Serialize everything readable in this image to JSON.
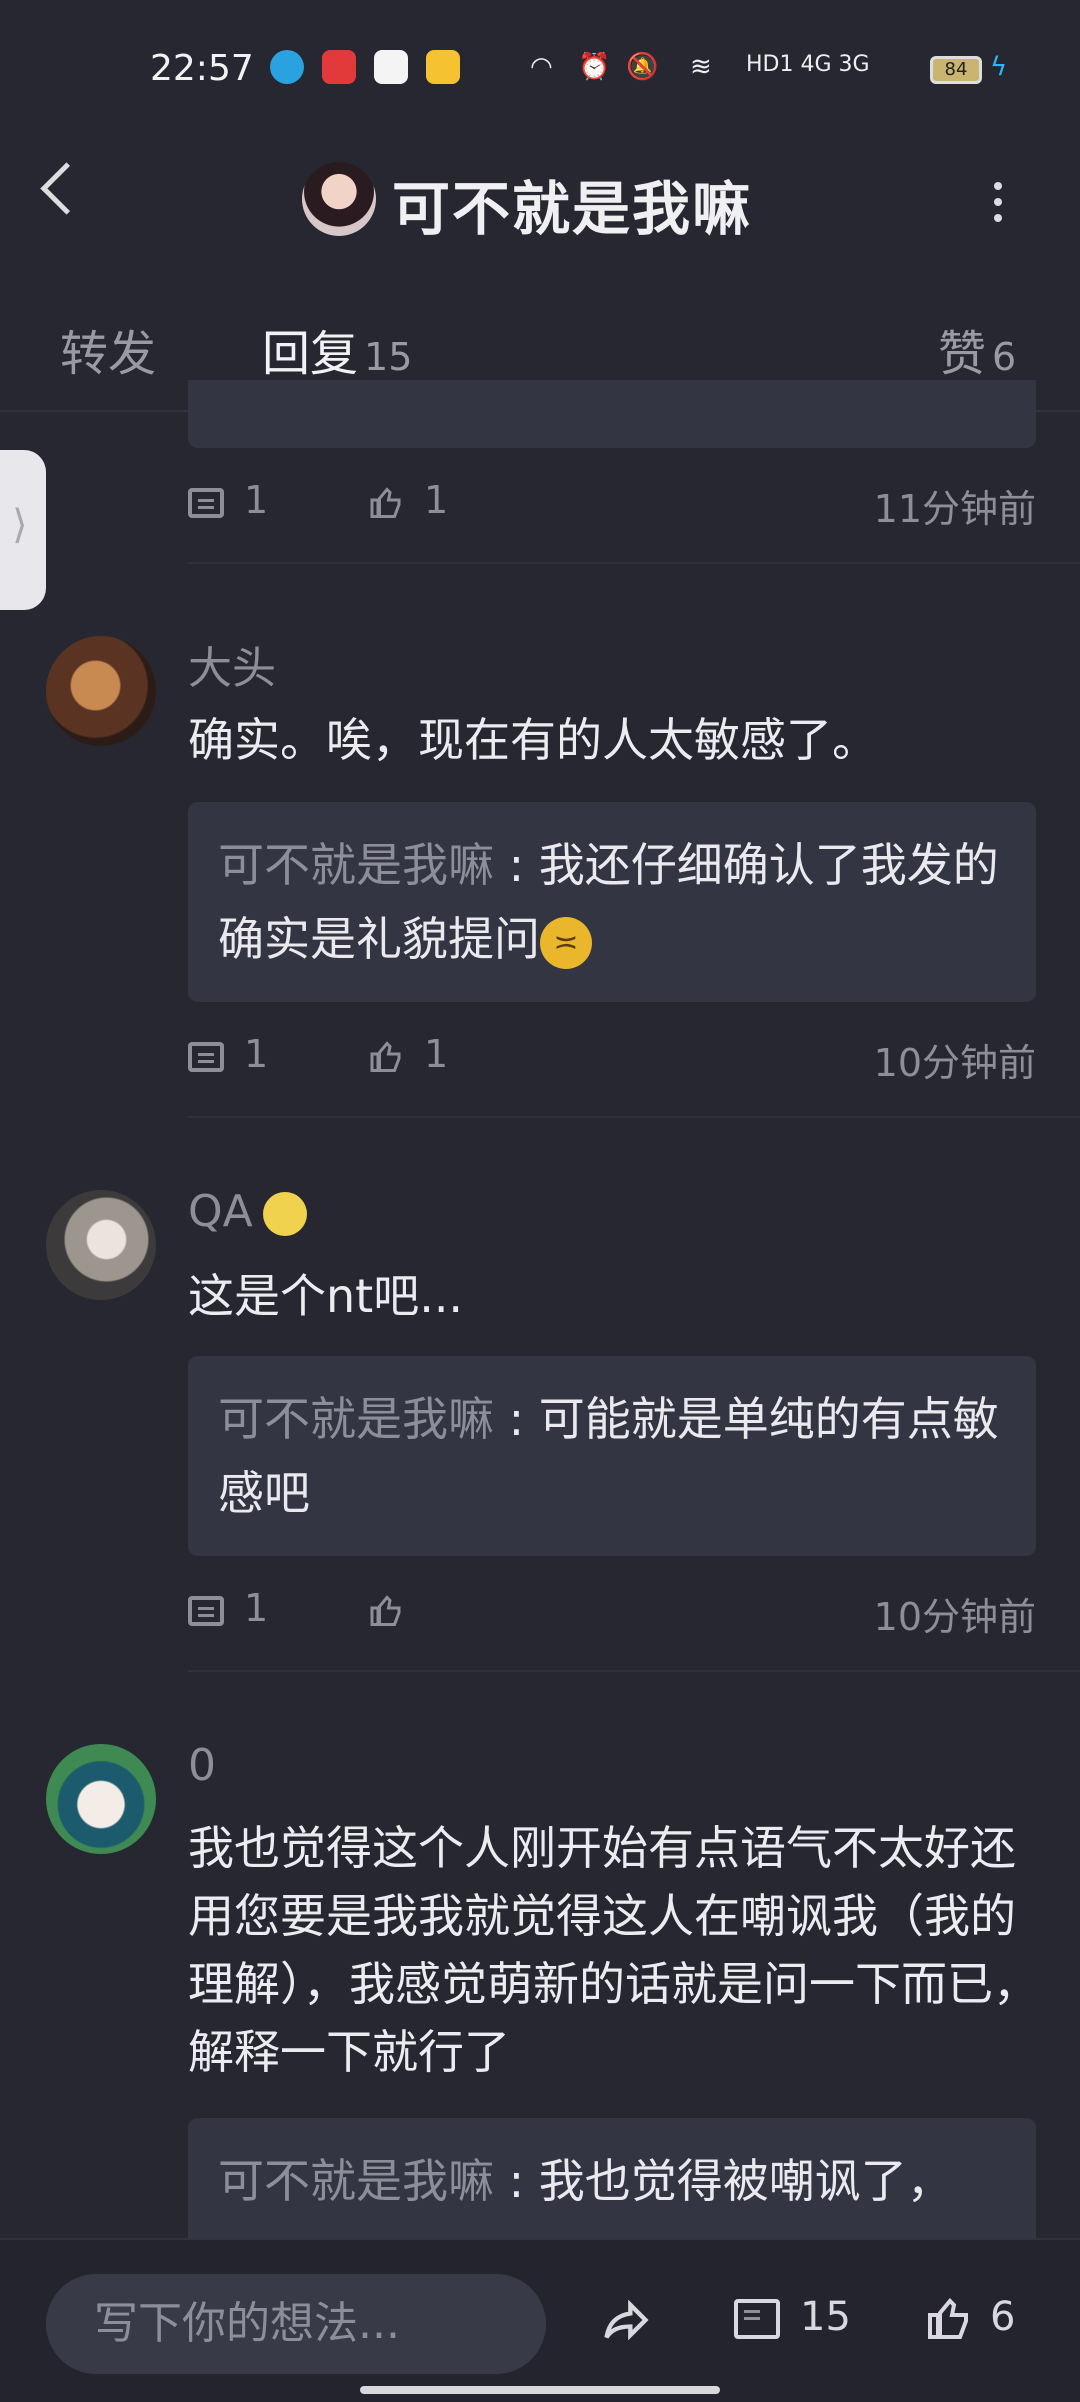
{
  "status_bar": {
    "time": "22:57",
    "app_icons": [
      "qq-icon",
      "xiaohongshu-icon",
      "tencent-video-icon",
      "weibo-icon"
    ],
    "network": "HD1 4G 3G",
    "battery": "84"
  },
  "header": {
    "title": "可不就是我嘛"
  },
  "tabs": {
    "forward": "转发",
    "reply": "回复",
    "reply_count": "15",
    "like": "赞",
    "like_count": "6"
  },
  "prev_item": {
    "reply_count": "1",
    "like_count": "1",
    "time": "11分钟前"
  },
  "comments": [
    {
      "user": "大头",
      "text": "确实。唉，现在有的人太敏感了。",
      "quote_name": "可不就是我嘛",
      "quote_sep": " : ",
      "quote_text": "我还仔细确认了我发的确实是礼貌提问",
      "reply_count": "1",
      "like_count": "1",
      "time": "10分钟前"
    },
    {
      "user": "QA",
      "text": "这是个nt吧...",
      "quote_name": "可不就是我嘛",
      "quote_sep": " : ",
      "quote_text": "可能就是单纯的有点敏感吧",
      "reply_count": "1",
      "like_count": "",
      "time": "10分钟前"
    },
    {
      "user": "0",
      "text": "我也觉得这个人刚开始有点语气不太好还用您要是我我就觉得这人在嘲讽我（我的理解），我感觉萌新的话就是问一下而已，解释一下就行了",
      "quote_name": "可不就是我嘛",
      "quote_sep": " : ",
      "quote_text": "我也觉得被嘲讽了，"
    }
  ],
  "bottom_bar": {
    "input_placeholder": "写下你的想法...",
    "comment_count": "15",
    "like_count": "6"
  },
  "colors": {
    "background": "#262731",
    "accent": "#29b5c5",
    "card": "#343542"
  }
}
